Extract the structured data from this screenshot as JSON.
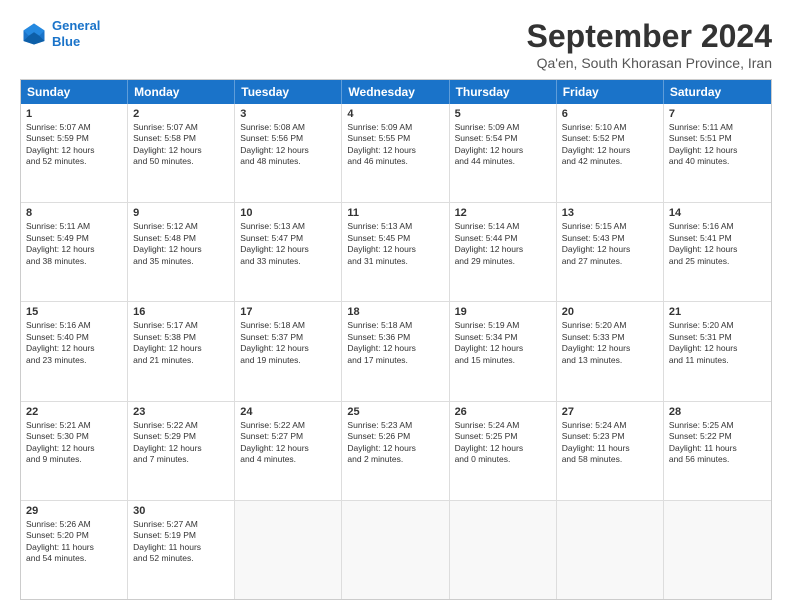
{
  "logo": {
    "line1": "General",
    "line2": "Blue"
  },
  "header": {
    "month": "September 2024",
    "location": "Qa'en, South Khorasan Province, Iran"
  },
  "weekdays": [
    "Sunday",
    "Monday",
    "Tuesday",
    "Wednesday",
    "Thursday",
    "Friday",
    "Saturday"
  ],
  "rows": [
    [
      {
        "day": "1",
        "text": "Sunrise: 5:07 AM\nSunset: 5:59 PM\nDaylight: 12 hours\nand 52 minutes."
      },
      {
        "day": "2",
        "text": "Sunrise: 5:07 AM\nSunset: 5:58 PM\nDaylight: 12 hours\nand 50 minutes."
      },
      {
        "day": "3",
        "text": "Sunrise: 5:08 AM\nSunset: 5:56 PM\nDaylight: 12 hours\nand 48 minutes."
      },
      {
        "day": "4",
        "text": "Sunrise: 5:09 AM\nSunset: 5:55 PM\nDaylight: 12 hours\nand 46 minutes."
      },
      {
        "day": "5",
        "text": "Sunrise: 5:09 AM\nSunset: 5:54 PM\nDaylight: 12 hours\nand 44 minutes."
      },
      {
        "day": "6",
        "text": "Sunrise: 5:10 AM\nSunset: 5:52 PM\nDaylight: 12 hours\nand 42 minutes."
      },
      {
        "day": "7",
        "text": "Sunrise: 5:11 AM\nSunset: 5:51 PM\nDaylight: 12 hours\nand 40 minutes."
      }
    ],
    [
      {
        "day": "8",
        "text": "Sunrise: 5:11 AM\nSunset: 5:49 PM\nDaylight: 12 hours\nand 38 minutes."
      },
      {
        "day": "9",
        "text": "Sunrise: 5:12 AM\nSunset: 5:48 PM\nDaylight: 12 hours\nand 35 minutes."
      },
      {
        "day": "10",
        "text": "Sunrise: 5:13 AM\nSunset: 5:47 PM\nDaylight: 12 hours\nand 33 minutes."
      },
      {
        "day": "11",
        "text": "Sunrise: 5:13 AM\nSunset: 5:45 PM\nDaylight: 12 hours\nand 31 minutes."
      },
      {
        "day": "12",
        "text": "Sunrise: 5:14 AM\nSunset: 5:44 PM\nDaylight: 12 hours\nand 29 minutes."
      },
      {
        "day": "13",
        "text": "Sunrise: 5:15 AM\nSunset: 5:43 PM\nDaylight: 12 hours\nand 27 minutes."
      },
      {
        "day": "14",
        "text": "Sunrise: 5:16 AM\nSunset: 5:41 PM\nDaylight: 12 hours\nand 25 minutes."
      }
    ],
    [
      {
        "day": "15",
        "text": "Sunrise: 5:16 AM\nSunset: 5:40 PM\nDaylight: 12 hours\nand 23 minutes."
      },
      {
        "day": "16",
        "text": "Sunrise: 5:17 AM\nSunset: 5:38 PM\nDaylight: 12 hours\nand 21 minutes."
      },
      {
        "day": "17",
        "text": "Sunrise: 5:18 AM\nSunset: 5:37 PM\nDaylight: 12 hours\nand 19 minutes."
      },
      {
        "day": "18",
        "text": "Sunrise: 5:18 AM\nSunset: 5:36 PM\nDaylight: 12 hours\nand 17 minutes."
      },
      {
        "day": "19",
        "text": "Sunrise: 5:19 AM\nSunset: 5:34 PM\nDaylight: 12 hours\nand 15 minutes."
      },
      {
        "day": "20",
        "text": "Sunrise: 5:20 AM\nSunset: 5:33 PM\nDaylight: 12 hours\nand 13 minutes."
      },
      {
        "day": "21",
        "text": "Sunrise: 5:20 AM\nSunset: 5:31 PM\nDaylight: 12 hours\nand 11 minutes."
      }
    ],
    [
      {
        "day": "22",
        "text": "Sunrise: 5:21 AM\nSunset: 5:30 PM\nDaylight: 12 hours\nand 9 minutes."
      },
      {
        "day": "23",
        "text": "Sunrise: 5:22 AM\nSunset: 5:29 PM\nDaylight: 12 hours\nand 7 minutes."
      },
      {
        "day": "24",
        "text": "Sunrise: 5:22 AM\nSunset: 5:27 PM\nDaylight: 12 hours\nand 4 minutes."
      },
      {
        "day": "25",
        "text": "Sunrise: 5:23 AM\nSunset: 5:26 PM\nDaylight: 12 hours\nand 2 minutes."
      },
      {
        "day": "26",
        "text": "Sunrise: 5:24 AM\nSunset: 5:25 PM\nDaylight: 12 hours\nand 0 minutes."
      },
      {
        "day": "27",
        "text": "Sunrise: 5:24 AM\nSunset: 5:23 PM\nDaylight: 11 hours\nand 58 minutes."
      },
      {
        "day": "28",
        "text": "Sunrise: 5:25 AM\nSunset: 5:22 PM\nDaylight: 11 hours\nand 56 minutes."
      }
    ],
    [
      {
        "day": "29",
        "text": "Sunrise: 5:26 AM\nSunset: 5:20 PM\nDaylight: 11 hours\nand 54 minutes."
      },
      {
        "day": "30",
        "text": "Sunrise: 5:27 AM\nSunset: 5:19 PM\nDaylight: 11 hours\nand 52 minutes."
      },
      {
        "day": "",
        "text": ""
      },
      {
        "day": "",
        "text": ""
      },
      {
        "day": "",
        "text": ""
      },
      {
        "day": "",
        "text": ""
      },
      {
        "day": "",
        "text": ""
      }
    ]
  ]
}
